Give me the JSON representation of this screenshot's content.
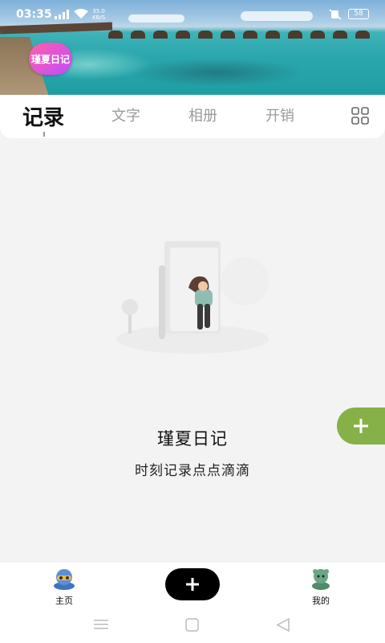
{
  "status_bar": {
    "time": "03:35",
    "net_speed_value": "35.0",
    "net_speed_unit": "KB/S",
    "battery": "58"
  },
  "header": {
    "logo_text": "瑾夏日记"
  },
  "tabs": [
    {
      "label": "记录",
      "active": true
    },
    {
      "label": "文字",
      "active": false
    },
    {
      "label": "相册",
      "active": false
    },
    {
      "label": "开销",
      "active": false
    }
  ],
  "empty_state": {
    "title": "瑾夏日记",
    "subtitle": "时刻记录点点滴滴"
  },
  "bottom_nav": {
    "home_label": "主页",
    "mine_label": "我的"
  },
  "colors": {
    "accent_green": "#86b048",
    "logo_gradient_start": "#ff5fa8",
    "logo_gradient_end": "#c34bff"
  },
  "icons": [
    "signal-icon",
    "wifi-icon",
    "mute-icon",
    "grid-icon",
    "add-icon",
    "home-avatar-icon",
    "mine-avatar-icon",
    "menu-nav-icon",
    "home-square-nav-icon",
    "back-nav-icon"
  ]
}
